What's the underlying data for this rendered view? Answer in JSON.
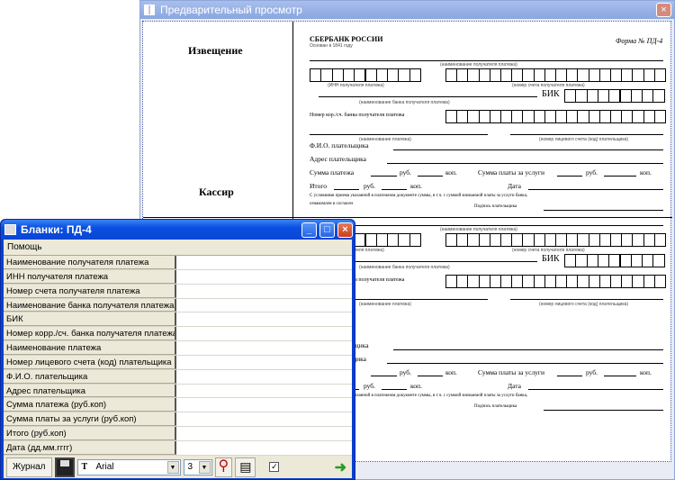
{
  "preview_window": {
    "title": "Предварительный просмотр",
    "close_label": "×",
    "left_column": {
      "notice": "Извещение",
      "cashier": "Кассир"
    },
    "form": {
      "bank_name": "СБЕРБАНК РОССИИ",
      "bank_founded": "Основан в 1841 году",
      "form_number": "Форма № ПД-4",
      "recipient_name_caption": "(наименование получателя платежа)",
      "inn_caption": "(ИНН получателя платежа)",
      "account_caption": "(номер счета получателя платежа)",
      "bank_caption": "(наименование банка получателя платежа)",
      "bik_label": "БИК",
      "corr_label": "Номер кор./сч. банка получателя платежа",
      "payment_caption": "(наименование платежа)",
      "personal_account_caption": "(номер лицевого счета (код) плательщика)",
      "fio_label": "Ф.И.О. плательщика",
      "address_label": "Адрес плательщика",
      "sum_label": "Сумма платежа",
      "rub": "руб.",
      "kop": "коп.",
      "service_label": "Сумма платы за услуги",
      "total_label": "Итого",
      "date_label": "Дата",
      "agreement_text": "С условиями приема указанной в платежном документе суммы, в т.ч. с суммой взимаемой платы за услуги банка,",
      "agreement_text2": "ознакомлен и согласен",
      "signature_label": "Подпись плательщика"
    }
  },
  "app_window": {
    "title": "Бланки: ПД-4",
    "controls": {
      "minimize": "_",
      "maximize": "□",
      "close": "×"
    },
    "menu": [
      "Помощь"
    ],
    "fields": [
      {
        "label": "Наименование получателя платежа",
        "value": ""
      },
      {
        "label": "ИНН получателя платежа",
        "value": ""
      },
      {
        "label": "Номер счета получателя платежа",
        "value": ""
      },
      {
        "label": "Наименование банка получателя платежа",
        "value": ""
      },
      {
        "label": "БИК",
        "value": ""
      },
      {
        "label": "Номер корр./сч. банка получателя платежа",
        "value": ""
      },
      {
        "label": "Наименование платежа",
        "value": ""
      },
      {
        "label": "Номер лицевого счета (код) плательщика",
        "value": ""
      },
      {
        "label": "Ф.И.О. плательщика",
        "value": ""
      },
      {
        "label": "Адрес плательщика",
        "value": ""
      },
      {
        "label": "Сумма платежа (руб.коп)",
        "value": ""
      },
      {
        "label": "Сумма платы за услуги (руб.коп)",
        "value": ""
      },
      {
        "label": "Итого (руб.коп)",
        "value": ""
      },
      {
        "label": "Дата (дд.мм.гггг)",
        "value": ""
      }
    ],
    "toolbar": {
      "journal_label": "Журнал",
      "font_value": "Arial",
      "size_value": "3",
      "checkbox_checked": true,
      "icons": [
        "save-icon",
        "font-icon",
        "magnifier-icon",
        "printer-icon",
        "exit-icon"
      ]
    }
  }
}
